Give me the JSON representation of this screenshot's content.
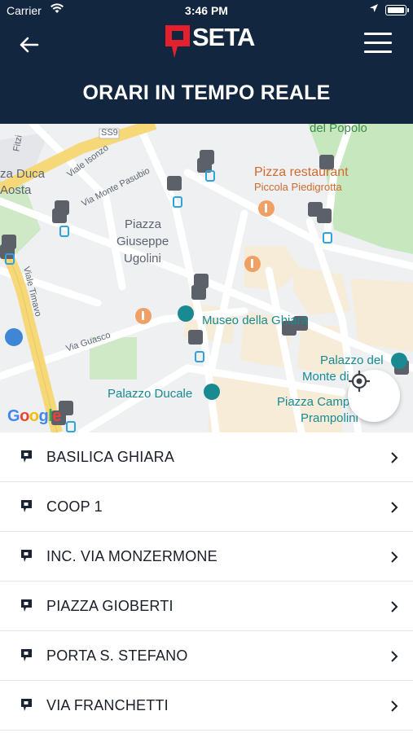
{
  "status_bar": {
    "carrier": "Carrier",
    "time": "3:46 PM"
  },
  "header": {
    "brand": "SETA",
    "title": "ORARI IN TEMPO REALE"
  },
  "map": {
    "labels": {
      "ss9": "SS9",
      "del_popolo": "del Popolo",
      "pizza_restaurant": "Pizza restaurant",
      "piccola_piedigrotta": "Piccola Piedigrotta",
      "duca": "za Duca",
      "aosta": "Aosta",
      "viale_isonzo": "Viale Isonzo",
      "via_monte_pasubio": "Via Monte Pasubio",
      "piazza_giuseppe_ugolini_1": "Piazza",
      "piazza_giuseppe_ugolini_2": "Giuseppe",
      "piazza_giuseppe_ugolini_3": "Ugolini",
      "viale_timavo": "Viale Timavo",
      "via_guasco": "Via Guasco",
      "museo": "Museo della Ghiara",
      "palazzo_ducale": "Palazzo Ducale",
      "palazzo_del": "Palazzo del",
      "monte_di": "Monte di",
      "piazza_camp": "Piazza Camp",
      "prampolini": "Prampolini",
      "fitz": "Fitzi",
      "google": "Google"
    }
  },
  "stops": [
    {
      "name": "BASILICA GHIARA"
    },
    {
      "name": "COOP 1"
    },
    {
      "name": "INC. VIA MONZERMONE"
    },
    {
      "name": "PIAZZA GIOBERTI"
    },
    {
      "name": "PORTA S. STEFANO"
    },
    {
      "name": "VIA FRANCHETTI"
    }
  ],
  "colors": {
    "header_bg": "#12263f",
    "brand_red": "#e5202e",
    "stop_icon": "#1a2233",
    "poi_teal": "#1a8a92"
  },
  "icons": {
    "back": "arrow-left-icon",
    "menu": "hamburger-icon",
    "locate": "crosshair-icon",
    "stop": "bus-stop-icon",
    "chevron": "chevron-right-icon"
  }
}
